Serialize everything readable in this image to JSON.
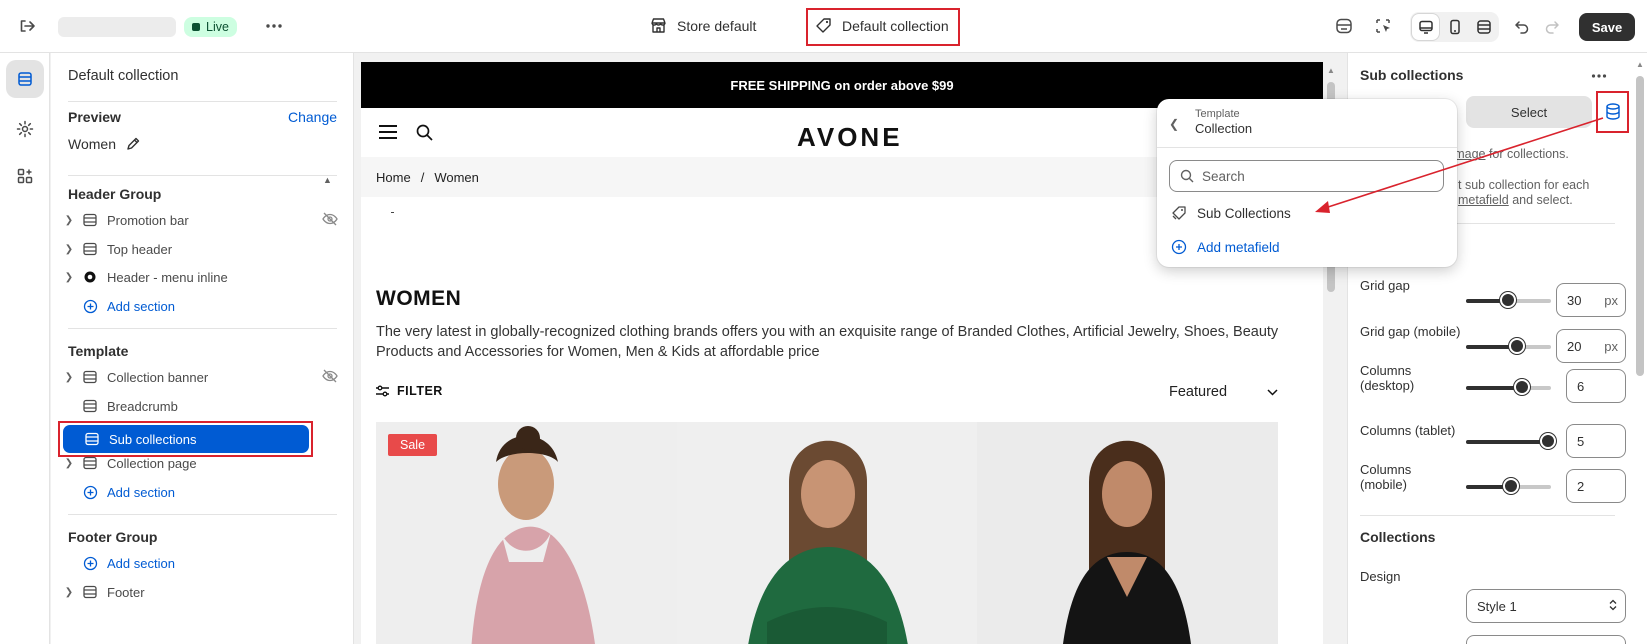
{
  "topbar": {
    "status": "Live",
    "theme_template": "Store default",
    "template_name": "Default collection",
    "save_label": "Save"
  },
  "left_panel": {
    "title": "Default collection",
    "preview_label": "Preview",
    "change_label": "Change",
    "preview_value": "Women",
    "header_group": {
      "title": "Header Group",
      "items": [
        "Promotion bar",
        "Top header",
        "Header - menu inline"
      ],
      "add": "Add section"
    },
    "template": {
      "title": "Template",
      "items": [
        "Collection banner",
        "Breadcrumb",
        "Sub collections",
        "Collection page"
      ],
      "add": "Add section"
    },
    "footer_group": {
      "title": "Footer Group",
      "add": "Add section",
      "items": [
        "Footer"
      ]
    }
  },
  "canvas": {
    "promo": "FREE SHIPPING on order above $99",
    "logo": "AVONE",
    "breadcrumb_home": "Home",
    "breadcrumb_sep": "/",
    "breadcrumb_current": "Women",
    "collection_title": "WOMEN",
    "collection_desc": "The very latest in globally-recognized clothing brands offers you with an exquisite range of Branded Clothes, Artificial Jewelry, Shoes, Beauty Products and Accessories for Women, Men & Kids at affordable price",
    "filter_label": "FILTER",
    "sort_value": "Featured",
    "sale_badge": "Sale"
  },
  "popup": {
    "kicker": "Template",
    "title": "Collection",
    "search_placeholder": "Search",
    "option": "Sub Collections",
    "add_metafield": "Add metafield"
  },
  "right_panel": {
    "title": "Sub collections",
    "select_label": "Select",
    "help1_link": "n image",
    "help1_rest": " for collections.",
    "help2_a": "t sub collection for each",
    "help2_link": "metafield",
    "help2_rest": " and select.",
    "section_title_partial": "e",
    "settings": [
      {
        "label": "Grid gap",
        "value": "30",
        "unit": "px",
        "level": 0.45
      },
      {
        "label": "Grid gap (mobile)",
        "value": "20",
        "unit": "px",
        "level": 0.6
      },
      {
        "label": "Columns (desktop)",
        "value": "6",
        "unit": "",
        "level": 0.65
      },
      {
        "label": "Columns (tablet)",
        "value": "5",
        "unit": "",
        "level": 0.95
      },
      {
        "label": "Columns (mobile)",
        "value": "2",
        "unit": "",
        "level": 0.5
      }
    ],
    "collections_title": "Collections",
    "design_label": "Design",
    "design_value": "Style 1"
  },
  "colors": {
    "accent": "#005bd3",
    "annotation": "#d9232d",
    "live_bg": "#cdfee1"
  }
}
